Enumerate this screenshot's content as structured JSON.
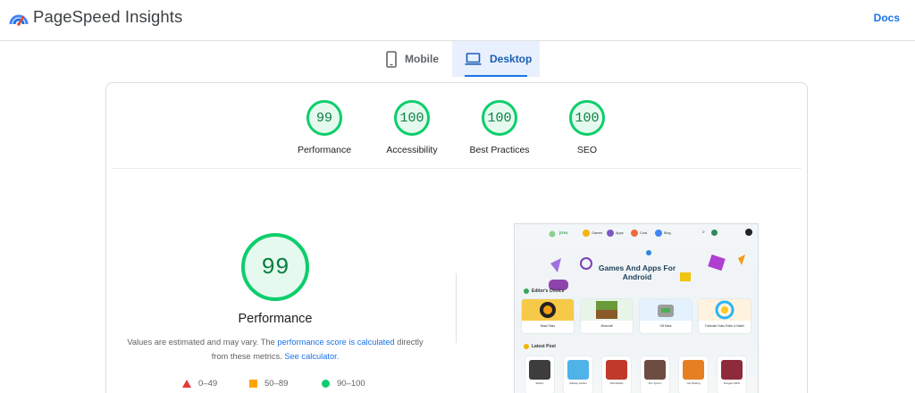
{
  "app": {
    "title": "PageSpeed Insights",
    "docs_label": "Docs"
  },
  "tabs": [
    {
      "label": "Mobile",
      "icon": "phone-icon",
      "active": false
    },
    {
      "label": "Desktop",
      "icon": "laptop-icon",
      "active": true
    }
  ],
  "scores": [
    {
      "label": "Performance",
      "value": "99"
    },
    {
      "label": "Accessibility",
      "value": "100"
    },
    {
      "label": "Best Practices",
      "value": "100"
    },
    {
      "label": "SEO",
      "value": "100"
    }
  ],
  "performance": {
    "score": "99",
    "label": "Performance",
    "desc_prefix": "Values are estimated and may vary. The ",
    "desc_link1": "performance score is calculated",
    "desc_middle": " directly from these metrics. ",
    "desc_link2": "See calculator."
  },
  "legend": [
    {
      "range": "0–49",
      "shape": "triangle",
      "color": "#e53935"
    },
    {
      "range": "50–89",
      "shape": "square",
      "color": "#ffa400"
    },
    {
      "range": "90–100",
      "shape": "circle",
      "color": "#0cce6b"
    }
  ],
  "thumbnail": {
    "site_logo": "jrtsv",
    "nav": [
      "Games",
      "Apps",
      "Cord",
      "Blog"
    ],
    "hero_title": "Games And Apps For Android",
    "editors_choice": "Editor's Choice",
    "editor_cards": [
      "Brawl Stars",
      "Minecraft",
      "GB Mask",
      "Funimate Video Editor & Maker"
    ],
    "latest_post": "Latest Post",
    "posts": [
      "Roblox",
      "Subway Surfers",
      "FIFA Mobile",
      "Kim Tycoon",
      "Car Parking",
      "Dungeon RPG"
    ]
  },
  "colors": {
    "good": "#0cce6b",
    "good_text": "#08803f",
    "link": "#1a73e8",
    "tab_active_bg": "#e8f0fe"
  }
}
